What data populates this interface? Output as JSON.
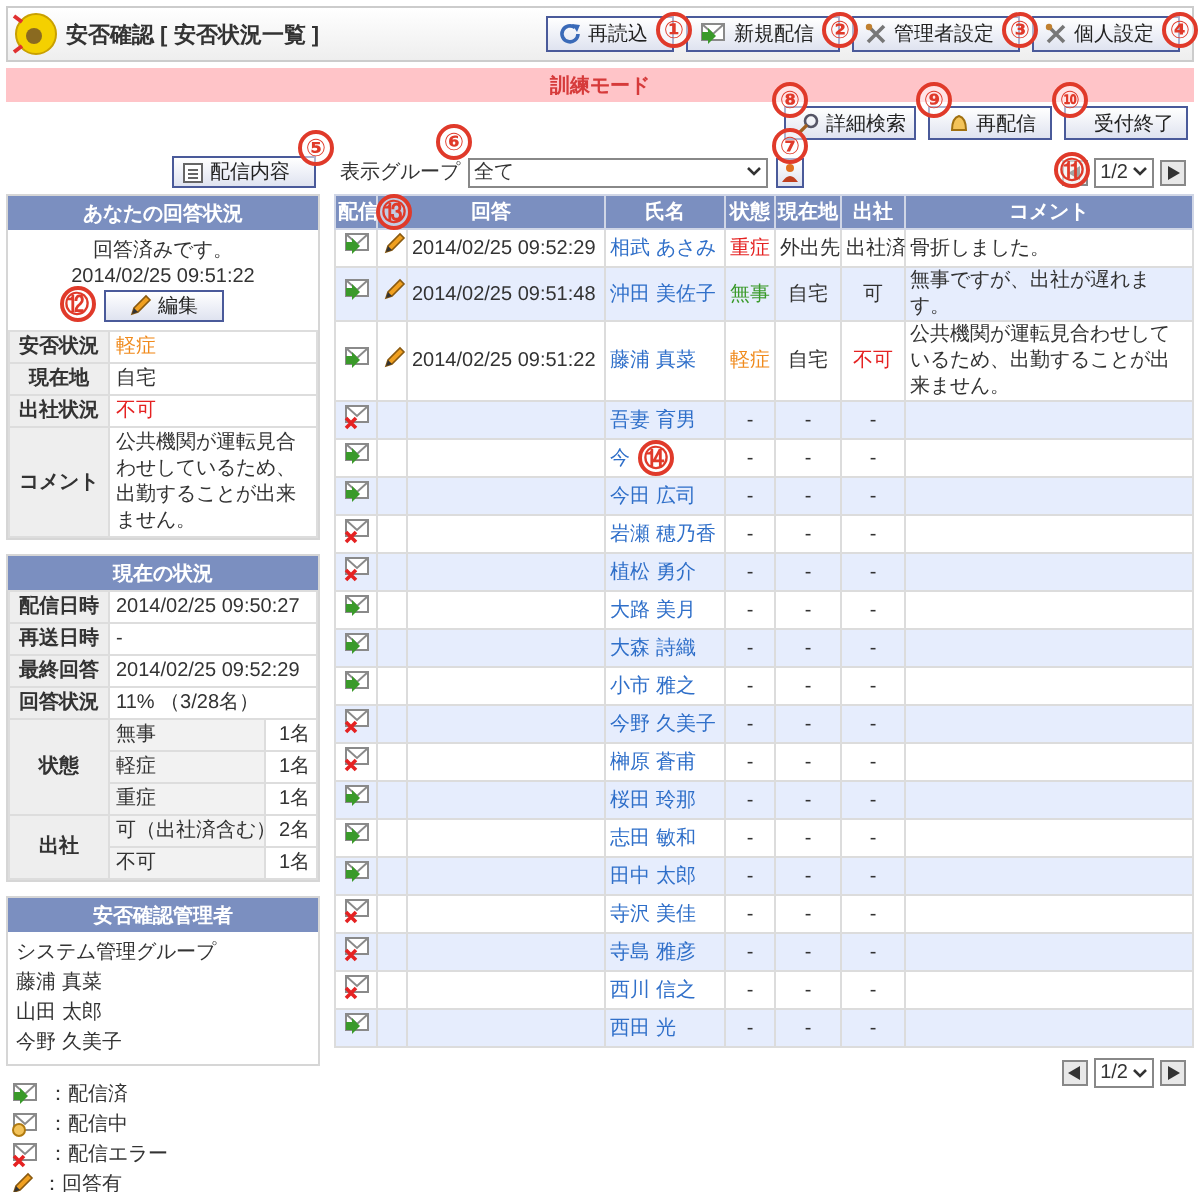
{
  "header": {
    "title": "安否確認 [ 安否状況一覧 ]",
    "buttons": [
      "再読込",
      "新規配信",
      "管理者設定",
      "個人設定"
    ]
  },
  "mode_banner": "訓練モード",
  "actions": [
    "詳細検索",
    "再配信",
    "受付終了"
  ],
  "toolbar": {
    "delivery_button": "配信内容",
    "group_label": "表示グループ",
    "group_value": "全て",
    "pager": "1/2"
  },
  "my_answer": {
    "title": "あなたの回答状況",
    "message": "回答済みです。",
    "time": "2014/02/25 09:51:22",
    "edit_button": "編集",
    "fields": [
      {
        "key": "安否状況",
        "value": "軽症",
        "color": "#f08a1c"
      },
      {
        "key": "現在地",
        "value": "自宅",
        "color": "#333333"
      },
      {
        "key": "出社状況",
        "value": "不可",
        "color": "#e52222"
      },
      {
        "key": "コメント",
        "value": "公共機関が運転見合わせしているため、出勤することが出来ません。",
        "color": "#333333"
      }
    ]
  },
  "current_status": {
    "title": "現在の状況",
    "fields": [
      {
        "key": "配信日時",
        "value": "2014/02/25 09:50:27"
      },
      {
        "key": "再送日時",
        "value": "-"
      },
      {
        "key": "最終回答",
        "value": "2014/02/25 09:52:29"
      },
      {
        "key": "回答状況",
        "value": "11% （3/28名）"
      }
    ],
    "groups": [
      {
        "key": "状態",
        "items": [
          {
            "label": "無事",
            "count": "1名"
          },
          {
            "label": "軽症",
            "count": "1名"
          },
          {
            "label": "重症",
            "count": "1名"
          }
        ]
      },
      {
        "key": "出社",
        "items": [
          {
            "label": "可（出社済含む）",
            "count": "2名"
          },
          {
            "label": "不可",
            "count": "1名"
          }
        ]
      }
    ]
  },
  "admins": {
    "title": "安否確認管理者",
    "members": [
      "システム管理グループ",
      "藤浦 真菜",
      "山田 太郎",
      "今野 久美子"
    ]
  },
  "legend": [
    {
      "kind": "sent",
      "label": "：配信済"
    },
    {
      "kind": "sending",
      "label": "：配信中"
    },
    {
      "kind": "error",
      "label": "：配信エラー"
    },
    {
      "kind": "answered",
      "label": "：回答有"
    }
  ],
  "table": {
    "columns": [
      "配信",
      "回答",
      "氏名",
      "状態",
      "現在地",
      "出社",
      "コメント"
    ],
    "rows": [
      {
        "kind": "sent",
        "answered": true,
        "time": "2014/02/25 09:52:29",
        "name": "相武 あさみ",
        "state": {
          "text": "重症",
          "color": "#e52222"
        },
        "location": "外出先",
        "attendance": {
          "text": "出社済",
          "color": "#333333"
        },
        "comment": "骨折しました。"
      },
      {
        "kind": "sent",
        "answered": true,
        "time": "2014/02/25 09:51:48",
        "name": "沖田 美佐子",
        "state": {
          "text": "無事",
          "color": "#3a9a2a"
        },
        "location": "自宅",
        "attendance": {
          "text": "可",
          "color": "#333333"
        },
        "comment": "無事ですが、出社が遅れます。"
      },
      {
        "kind": "sent",
        "answered": true,
        "time": "2014/02/25 09:51:22",
        "name": "藤浦 真菜",
        "state": {
          "text": "軽症",
          "color": "#f08a1c"
        },
        "location": "自宅",
        "attendance": {
          "text": "不可",
          "color": "#e52222"
        },
        "comment": "公共機関が運転見合わせしているため、出勤することが出来ません。"
      },
      {
        "kind": "error",
        "answered": false,
        "name": "吾妻 育男",
        "state": {
          "text": "-",
          "color": "#333333"
        },
        "location": "-",
        "attendance": {
          "text": "-",
          "color": "#333333"
        }
      },
      {
        "kind": "sent",
        "answered": false,
        "name": "今",
        "state": {
          "text": "-",
          "color": "#333333"
        },
        "location": "-",
        "attendance": {
          "text": "-",
          "color": "#333333"
        }
      },
      {
        "kind": "sent",
        "answered": false,
        "name": "今田 広司",
        "state": {
          "text": "-",
          "color": "#333333"
        },
        "location": "-",
        "attendance": {
          "text": "-",
          "color": "#333333"
        }
      },
      {
        "kind": "error",
        "answered": false,
        "name": "岩瀬 穂乃香",
        "state": {
          "text": "-",
          "color": "#333333"
        },
        "location": "-",
        "attendance": {
          "text": "-",
          "color": "#333333"
        }
      },
      {
        "kind": "error",
        "answered": false,
        "name": "植松 勇介",
        "state": {
          "text": "-",
          "color": "#333333"
        },
        "location": "-",
        "attendance": {
          "text": "-",
          "color": "#333333"
        }
      },
      {
        "kind": "sent",
        "answered": false,
        "name": "大路 美月",
        "state": {
          "text": "-",
          "color": "#333333"
        },
        "location": "-",
        "attendance": {
          "text": "-",
          "color": "#333333"
        }
      },
      {
        "kind": "sent",
        "answered": false,
        "name": "大森 詩織",
        "state": {
          "text": "-",
          "color": "#333333"
        },
        "location": "-",
        "attendance": {
          "text": "-",
          "color": "#333333"
        }
      },
      {
        "kind": "sent",
        "answered": false,
        "name": "小市 雅之",
        "state": {
          "text": "-",
          "color": "#333333"
        },
        "location": "-",
        "attendance": {
          "text": "-",
          "color": "#333333"
        }
      },
      {
        "kind": "error",
        "answered": false,
        "name": "今野 久美子",
        "state": {
          "text": "-",
          "color": "#333333"
        },
        "location": "-",
        "attendance": {
          "text": "-",
          "color": "#333333"
        }
      },
      {
        "kind": "error",
        "answered": false,
        "name": "榊原 蒼甫",
        "state": {
          "text": "-",
          "color": "#333333"
        },
        "location": "-",
        "attendance": {
          "text": "-",
          "color": "#333333"
        }
      },
      {
        "kind": "sent",
        "answered": false,
        "name": "桜田 玲那",
        "state": {
          "text": "-",
          "color": "#333333"
        },
        "location": "-",
        "attendance": {
          "text": "-",
          "color": "#333333"
        }
      },
      {
        "kind": "sent",
        "answered": false,
        "name": "志田 敏和",
        "state": {
          "text": "-",
          "color": "#333333"
        },
        "location": "-",
        "attendance": {
          "text": "-",
          "color": "#333333"
        }
      },
      {
        "kind": "sent",
        "answered": false,
        "name": "田中 太郎",
        "state": {
          "text": "-",
          "color": "#333333"
        },
        "location": "-",
        "attendance": {
          "text": "-",
          "color": "#333333"
        }
      },
      {
        "kind": "error",
        "answered": false,
        "name": "寺沢 美佳",
        "state": {
          "text": "-",
          "color": "#333333"
        },
        "location": "-",
        "attendance": {
          "text": "-",
          "color": "#333333"
        }
      },
      {
        "kind": "error",
        "answered": false,
        "name": "寺島 雅彦",
        "state": {
          "text": "-",
          "color": "#333333"
        },
        "location": "-",
        "attendance": {
          "text": "-",
          "color": "#333333"
        }
      },
      {
        "kind": "error",
        "answered": false,
        "name": "西川 信之",
        "state": {
          "text": "-",
          "color": "#333333"
        },
        "location": "-",
        "attendance": {
          "text": "-",
          "color": "#333333"
        }
      },
      {
        "kind": "sent",
        "answered": false,
        "name": "西田 光",
        "state": {
          "text": "-",
          "color": "#333333"
        },
        "location": "-",
        "attendance": {
          "text": "-",
          "color": "#333333"
        }
      }
    ]
  },
  "bottom_pager": "1/2",
  "callouts": [
    "①",
    "②",
    "③",
    "④",
    "⑤",
    "⑥",
    "⑦",
    "⑧",
    "⑨",
    "⑩",
    "⑪",
    "⑫",
    "⑬",
    "⑭"
  ]
}
